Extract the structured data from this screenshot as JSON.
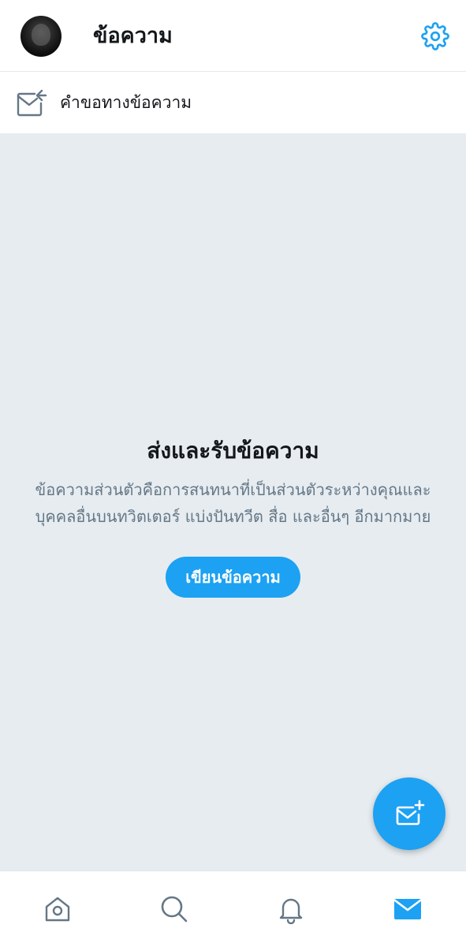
{
  "header": {
    "title": "ข้อความ",
    "avatar_icon": "user-avatar",
    "settings_icon": "gear-icon"
  },
  "message_requests": {
    "label": "คำขอทางข้อความ",
    "icon": "envelope-arrow-icon"
  },
  "empty_state": {
    "title": "ส่งและรับข้อความ",
    "description": "ข้อความส่วนตัวคือการสนทนาที่เป็นส่วนตัวระหว่างคุณและบุคคลอื่นบนทวิตเตอร์ แบ่งปันทวีต สื่อ และอื่นๆ อีกมากมาย",
    "button_label": "เขียนข้อความ"
  },
  "fab": {
    "icon": "new-message-icon"
  },
  "bottom_nav": {
    "items": [
      {
        "name": "home",
        "icon": "home-icon"
      },
      {
        "name": "search",
        "icon": "search-icon"
      },
      {
        "name": "notifications",
        "icon": "bell-icon"
      },
      {
        "name": "messages",
        "icon": "envelope-icon",
        "active": true
      }
    ]
  },
  "colors": {
    "accent": "#1da1f2",
    "background": "#e6ecf0",
    "text_primary": "#14171a",
    "text_secondary": "#657786",
    "icon_inactive": "#657786"
  }
}
